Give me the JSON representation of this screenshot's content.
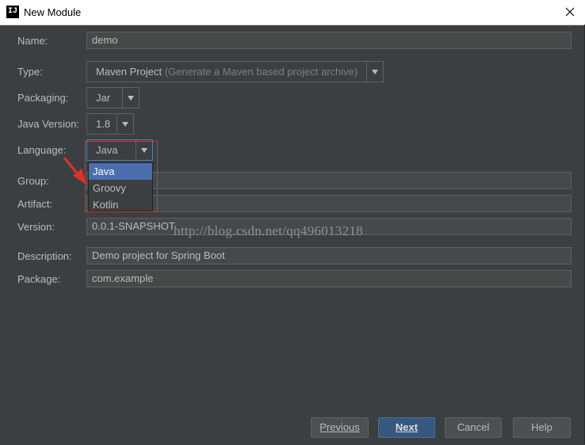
{
  "window": {
    "title": "New Module",
    "icon_text": "IJ"
  },
  "form": {
    "name": {
      "label": "Name:",
      "value": "demo"
    },
    "type": {
      "label": "Type:",
      "value": "Maven Project",
      "hint": "(Generate a Maven based project archive)"
    },
    "packaging": {
      "label": "Packaging:",
      "value": "Jar"
    },
    "java_version": {
      "label": "Java Version:",
      "value": "1.8"
    },
    "language": {
      "label": "Language:",
      "value": "Java",
      "options": [
        "Java",
        "Groovy",
        "Kotlin"
      ],
      "selected": "Java"
    },
    "group": {
      "label": "Group:",
      "value": ""
    },
    "artifact": {
      "label": "Artifact:",
      "value": ""
    },
    "version": {
      "label": "Version:",
      "value": "0.0.1-SNAPSHOT"
    },
    "description": {
      "label": "Description:",
      "value": "Demo project for Spring Boot"
    },
    "package": {
      "label": "Package:",
      "value": "com.example"
    }
  },
  "watermark": "http://blog.csdn.net/qq496013218",
  "buttons": {
    "previous": "Previous",
    "next": "Next",
    "cancel": "Cancel",
    "help": "Help"
  },
  "colors": {
    "background": "#3c3f41",
    "field": "#45494a",
    "selection": "#4b6eaf",
    "annotation": "#e0302a",
    "default_button": "#365880"
  }
}
